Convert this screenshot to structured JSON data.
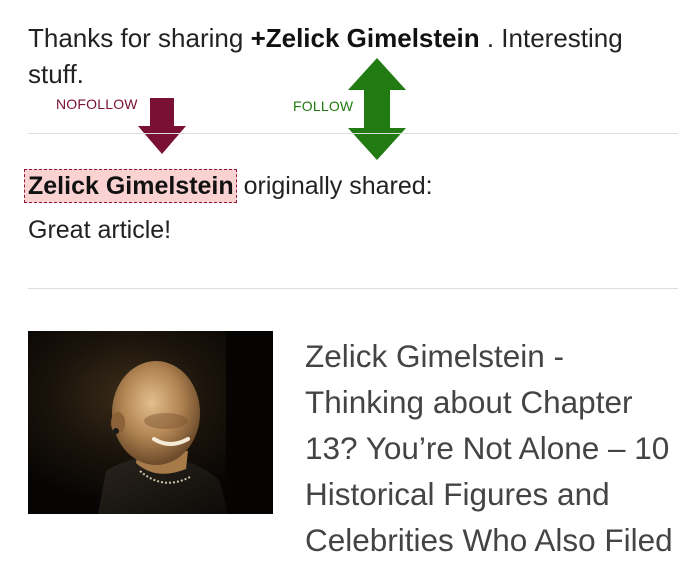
{
  "post": {
    "intro_before": "Thanks for sharing ",
    "mention": "+Zelick Gimelstein",
    "intro_after": " . Interesting stuff."
  },
  "annotations": {
    "nofollow_label": "NOFOLLOW",
    "nofollow_color": "#7a1033",
    "follow_label": "FOLLOW",
    "follow_color": "#217a12"
  },
  "shared": {
    "author": "Zelick Gimelstein",
    "verb": "originally shared:",
    "comment": "Great article!"
  },
  "link_preview": {
    "title": "Zelick Gimelstein - Thinking about Chapter 13? You’re Not Alone – 10 Historical Figures and Celebrities Who Also Filed"
  },
  "colors": {
    "highlight_fill": "#fbd2d2",
    "highlight_border": "#8b1a3a",
    "divider": "#dddddd"
  }
}
